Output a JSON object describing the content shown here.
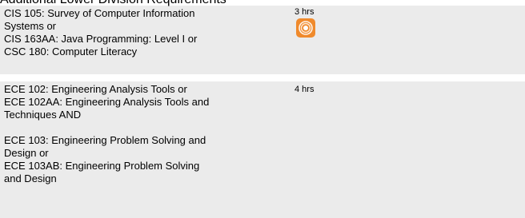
{
  "section": {
    "heading": "Additional Lower Division Requirements"
  },
  "requirements": [
    {
      "lines": [
        "CIS 105: Survey of Computer Information",
        "Systems or",
        "CIS 163AA: Java Programming: Level I or",
        "CSC 180: Computer Literacy"
      ],
      "hours": "3 hrs",
      "icon": "audio-play-icon",
      "icon_color": "#f08a2c"
    },
    {
      "group1": [
        "ECE 102: Engineering Analysis Tools or",
        "ECE 102AA: Engineering Analysis Tools and",
        "Techniques AND"
      ],
      "group2": [
        "ECE 103: Engineering Problem Solving and",
        "Design or",
        "ECE 103AB: Engineering Problem Solving",
        "and Design"
      ],
      "hours": "4 hrs"
    }
  ],
  "colors": {
    "row_background": "#ebebeb",
    "page_background": "#ffffff"
  }
}
